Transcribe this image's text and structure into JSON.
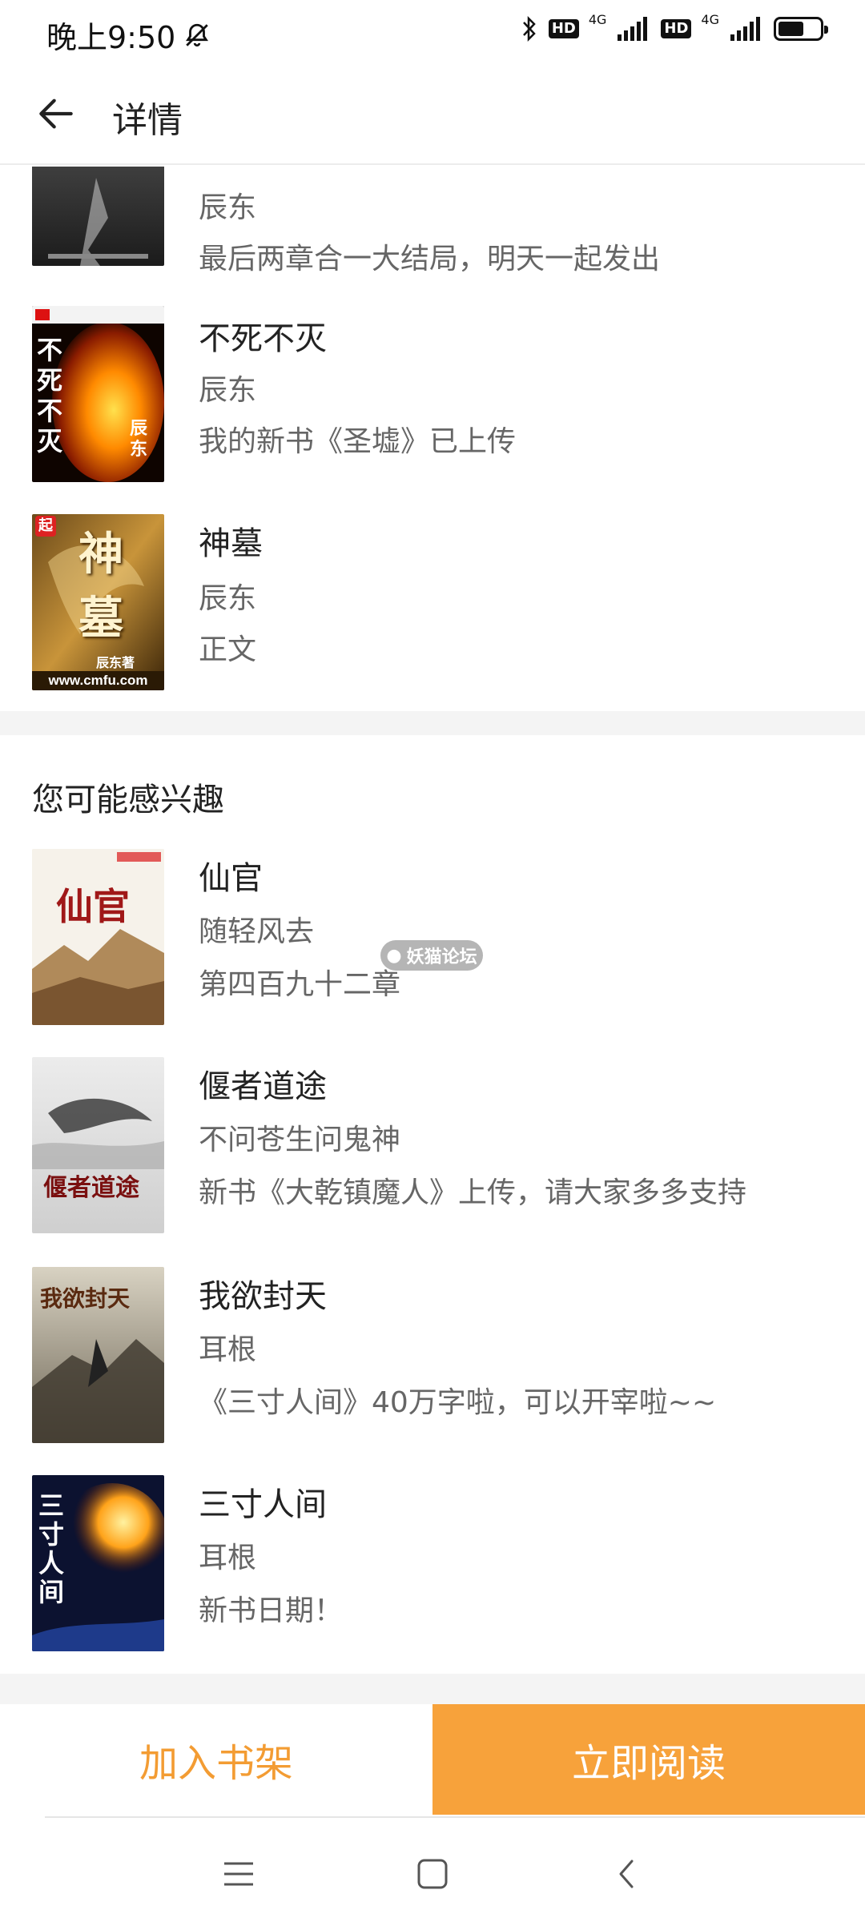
{
  "status_bar": {
    "time": "晚上9:50",
    "mute_icon": "bell-off-icon",
    "bluetooth_icon": "bluetooth-icon",
    "sim1": {
      "hd": "HD",
      "network": "4G"
    },
    "sim2": {
      "hd": "HD",
      "network": "4G"
    },
    "battery_level": 0.62
  },
  "header": {
    "back_icon": "arrow-left-icon",
    "title": "详情"
  },
  "same_author_books": [
    {
      "title": "",
      "author": "辰东",
      "latest": "最后两章合一大结局，明天一起发出"
    },
    {
      "title": "不死不灭",
      "author": "辰东",
      "latest": "我的新书《圣墟》已上传",
      "cover_text": "不死不灭",
      "cover_author": "辰东"
    },
    {
      "title": "神墓",
      "author": "辰东",
      "latest": "正文",
      "cover_text": "神墓",
      "cover_badge": "起",
      "cover_site": "www.cmfu.com",
      "cover_author": "辰东著"
    }
  ],
  "recommend": {
    "section_title": "您可能感兴趣",
    "books": [
      {
        "title": "仙官",
        "author": "随轻风去",
        "latest": "第四百九十二章",
        "cover_text": "仙官"
      },
      {
        "title": "偃者道途",
        "author": "不问苍生问鬼神",
        "latest": "新书《大乾镇魔人》上传，请大家多多支持",
        "cover_text": "偃者道途"
      },
      {
        "title": "我欲封天",
        "author": "耳根",
        "latest": "《三寸人间》40万字啦，可以开宰啦~~",
        "cover_text": "我欲封天"
      },
      {
        "title": "三寸人间",
        "author": "耳根",
        "latest": "新书日期！",
        "cover_text": "三寸人间"
      }
    ]
  },
  "watermark": {
    "text": "妖猫论坛"
  },
  "actions": {
    "add_shelf": "加入书架",
    "read_now": "立即阅读"
  },
  "colors": {
    "accent": "#f7a23b",
    "accent_text": "#f39c33"
  },
  "system_nav": {
    "menu_icon": "menu-icon",
    "home_icon": "home-square-icon",
    "back_icon": "chevron-left-icon"
  }
}
